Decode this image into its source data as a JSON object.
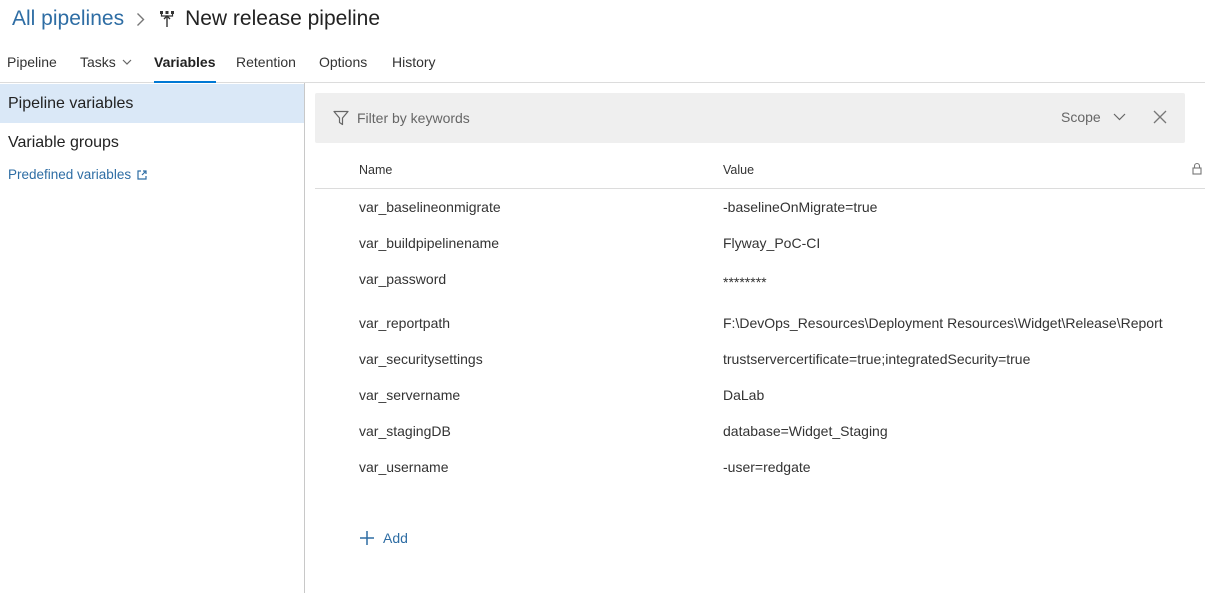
{
  "breadcrumb": {
    "parent": "All pipelines",
    "title": "New release pipeline"
  },
  "tabs": [
    {
      "label": "Pipeline"
    },
    {
      "label": "Tasks"
    },
    {
      "label": "Variables",
      "active": true
    },
    {
      "label": "Retention"
    },
    {
      "label": "Options"
    },
    {
      "label": "History"
    }
  ],
  "sidebar": {
    "items": [
      {
        "label": "Pipeline variables",
        "selected": true
      },
      {
        "label": "Variable groups"
      }
    ],
    "link": "Predefined variables"
  },
  "filter": {
    "placeholder": "Filter by keywords",
    "scope_label": "Scope"
  },
  "grid": {
    "columns": {
      "name": "Name",
      "value": "Value"
    },
    "rows": [
      {
        "name": "var_baselineonmigrate",
        "value": "-baselineOnMigrate=true"
      },
      {
        "name": "var_buildpipelinename",
        "value": "Flyway_PoC-CI"
      },
      {
        "name": "var_password",
        "value": "********"
      },
      {
        "name": "var_reportpath",
        "value": "F:\\DevOps_Resources\\Deployment Resources\\Widget\\Release\\Report"
      },
      {
        "name": "var_securitysettings",
        "value": "trustservercertificate=true;integratedSecurity=true"
      },
      {
        "name": "var_servername",
        "value": "DaLab"
      },
      {
        "name": "var_stagingDB",
        "value": "database=Widget_Staging"
      },
      {
        "name": "var_username",
        "value": "-user=redgate"
      }
    ]
  },
  "add_label": "Add",
  "colors": {
    "accent": "#0078d4",
    "link": "#2e6da4",
    "selected_bg": "#dae8f7",
    "filter_bg": "#efefef"
  }
}
